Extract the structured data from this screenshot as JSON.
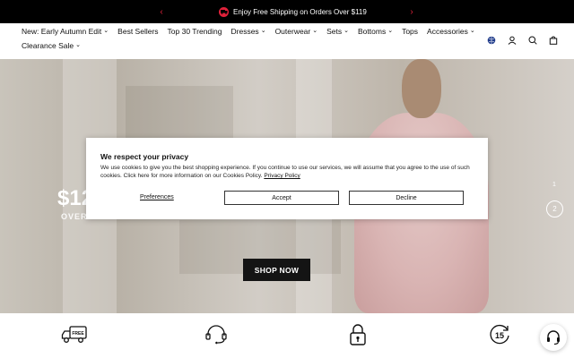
{
  "announcement": {
    "text": "Enjoy Free Shipping on Orders Over $119",
    "prev_glyph": "‹",
    "next_glyph": "›"
  },
  "nav": {
    "items": [
      {
        "label": "New: Early Autumn Edit",
        "has_dropdown": true
      },
      {
        "label": "Best Sellers",
        "has_dropdown": false
      },
      {
        "label": "Top 30 Trending",
        "has_dropdown": false
      },
      {
        "label": "Dresses",
        "has_dropdown": true
      },
      {
        "label": "Outerwear",
        "has_dropdown": true
      },
      {
        "label": "Sets",
        "has_dropdown": true
      },
      {
        "label": "Bottoms",
        "has_dropdown": true
      },
      {
        "label": "Tops",
        "has_dropdown": false
      },
      {
        "label": "Accessories",
        "has_dropdown": true
      },
      {
        "label": "Clearance Sale",
        "has_dropdown": true
      }
    ],
    "chevron": "⌄",
    "icons": [
      "globe-icon",
      "account-icon",
      "search-icon",
      "cart-icon"
    ]
  },
  "hero": {
    "price_text": "$12",
    "over_text": "OVER",
    "cta": "SHOP NOW",
    "slide_1": "1",
    "slide_2": "2"
  },
  "cookie": {
    "title": "We respect your privacy",
    "body": "We use cookies to give you the best shopping experience. If you continue to use our services, we will assume that you agree to the use of such cookies. Click here for more information on our Cookies Policy.",
    "policy_link": "Privacy Policy",
    "preferences": "Preferences",
    "accept": "Accept",
    "decline": "Decline"
  },
  "services": {
    "free_label": "FREE",
    "returns_days": "15",
    "icons": [
      "free-shipping-icon",
      "customer-service-icon",
      "secure-payment-icon",
      "returns-icon"
    ]
  },
  "colors": {
    "accent": "#e0213a",
    "dark": "#141414"
  }
}
